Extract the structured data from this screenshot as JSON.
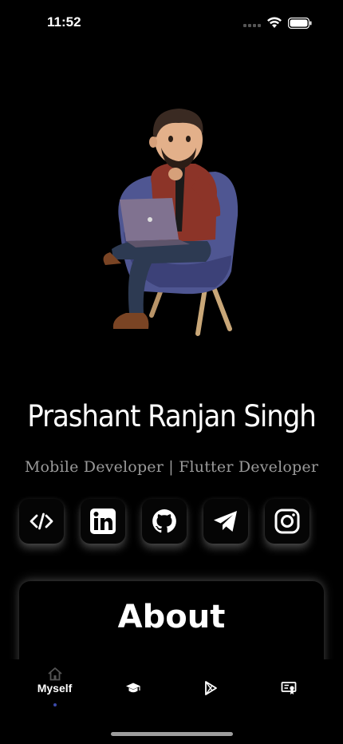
{
  "status_bar": {
    "time": "11:52"
  },
  "profile": {
    "name": "Prashant Ranjan Singh",
    "role": "Mobile Developer | Flutter Developer"
  },
  "socials": [
    {
      "icon": "code-icon"
    },
    {
      "icon": "linkedin-icon"
    },
    {
      "icon": "github-icon"
    },
    {
      "icon": "telegram-icon"
    },
    {
      "icon": "instagram-icon"
    }
  ],
  "about": {
    "title": "About"
  },
  "bottom_nav": {
    "items": [
      {
        "label": "Myself",
        "icon": "home-icon",
        "active": true
      },
      {
        "label": "",
        "icon": "graduation-cap-icon",
        "active": false
      },
      {
        "label": "",
        "icon": "play-store-icon",
        "active": false
      },
      {
        "label": "",
        "icon": "certificate-icon",
        "active": false
      }
    ]
  },
  "colors": {
    "background": "#000000",
    "accent": "#3b4aa8",
    "muted_text": "#9a9a9a"
  }
}
